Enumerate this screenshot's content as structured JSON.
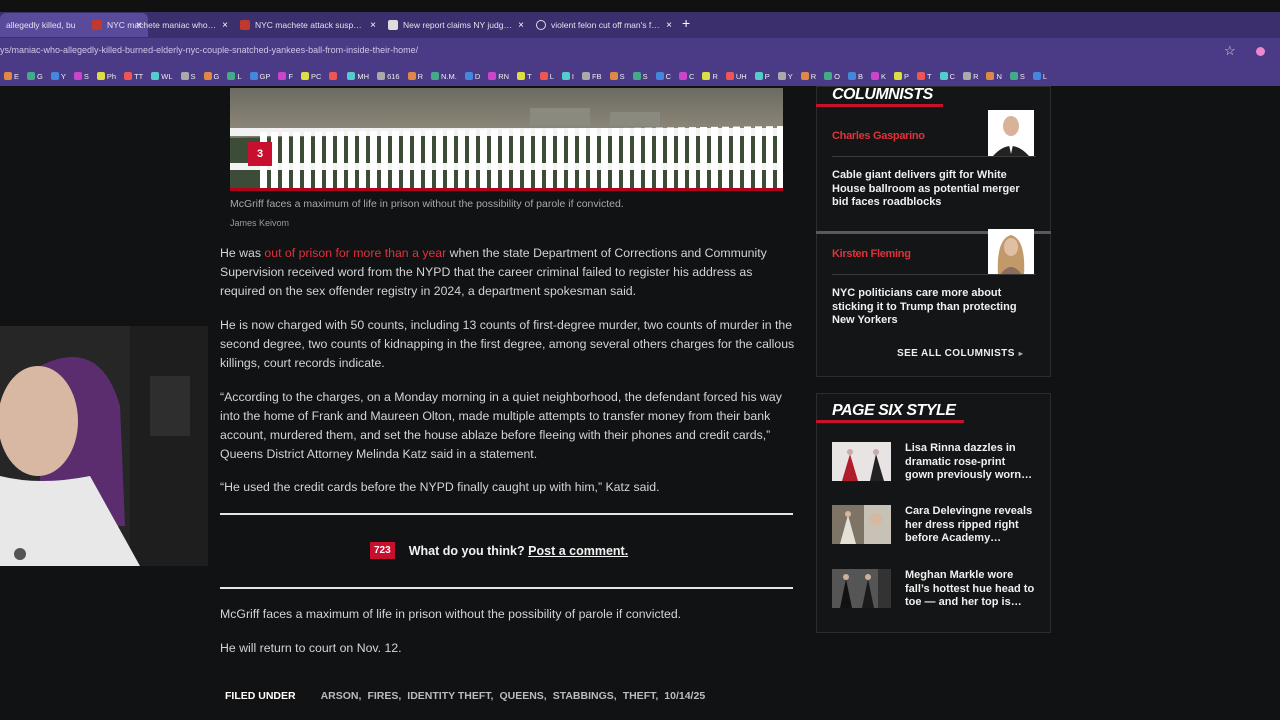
{
  "browser": {
    "tabs": [
      {
        "title": "allegedly killed, bu",
        "active": true
      },
      {
        "title": "NYC machete maniac who slic",
        "active": false
      },
      {
        "title": "NYC machete attack suspect ch",
        "active": false
      },
      {
        "title": "New report claims NY judges a",
        "active": false
      },
      {
        "title": "violent felon cut off man's fing",
        "active": false
      }
    ],
    "close_glyph": "×",
    "new_tab_glyph": "+",
    "url": "ys/maniac-who-allegedly-killed-burned-elderly-nyc-couple-snatched-yankees-ball-from-inside-their-home/",
    "bookmarks": [
      "E",
      "G",
      "Y",
      "S",
      "Ph",
      "TT",
      "WL",
      "S",
      "G",
      "L",
      "GP",
      "F",
      "PC",
      "",
      "MH",
      "616",
      "R",
      "N.M.",
      "D",
      "RN",
      "T",
      "L",
      "I",
      "FB",
      "S",
      "S",
      "C",
      "C",
      "R",
      "UH",
      "P",
      "Y",
      "R",
      "O",
      "B",
      "K",
      "P",
      "T",
      "C",
      "R",
      "N",
      "S",
      "L"
    ]
  },
  "article": {
    "photo_number": "3",
    "caption": "McGriff faces a maximum of life in prison without the possibility of parole if convicted.",
    "credit": "James Keivom",
    "p1_pre": "He was ",
    "p1_link": "out of prison for more than a year",
    "p1_post": " when the state Department of Corrections and Community Supervision received word from the NYPD that the career criminal failed to register his address as required on the sex offender registry in 2024, a department spokesman said.",
    "p2": "He is now charged with 50 counts, including 13 counts of first-degree murder, two counts of murder in the second degree, two counts of kidnapping in the first degree, among several others charges for the callous killings, court records indicate.",
    "p3": "“According to the charges, on a Monday morning in a quiet neighborhood, the defendant forced his way into the home of Frank and Maureen Olton, made multiple attempts to transfer money from their bank account, murdered them, and set the house ablaze before fleeing with their phones and credit cards,” Queens District Attorney Melinda Katz said in a statement.",
    "p4": "“He used the credit cards before the NYPD finally caught up with him,” Katz said.",
    "comment_count": "723",
    "comment_prompt": "What do you think?",
    "comment_link": "Post a comment.",
    "p5": "McGriff faces a maximum of life in prison without the possibility of parole if convicted.",
    "p6": "He will return to court on Nov. 12.",
    "filed_under_label": "FILED UNDER",
    "tags": [
      "ARSON,",
      "FIRES,",
      "IDENTITY THEFT,",
      "QUEENS,",
      "STABBINGS,",
      "THEFT,",
      "10/14/25"
    ]
  },
  "sidebar": {
    "columnists_heading": "COLUMNISTS",
    "columnists": [
      {
        "name": "Charles Gasparino",
        "headline": "Cable giant delivers gift for White House ballroom as potential merger bid faces roadblocks"
      },
      {
        "name": "Kirsten Fleming",
        "headline": "NYC politicians care more about sticking it to Trump than protecting New Yorkers"
      }
    ],
    "see_all": "SEE ALL COLUMNISTS",
    "see_all_arrow": "▸",
    "page_six_heading": "PAGE SIX STYLE",
    "page_six_items": [
      {
        "title": "Lisa Rinna dazzles in dramatic rose-print gown previously worn…"
      },
      {
        "title": "Cara Delevingne reveals her dress ripped right before Academy…"
      },
      {
        "title": "Meghan Markle wore fall’s hottest hue head to toe — and her top is…"
      }
    ]
  },
  "colors": {
    "accent_red": "#c8102e",
    "link_red": "#e0323b",
    "browser_purple": "#4b3a86"
  }
}
